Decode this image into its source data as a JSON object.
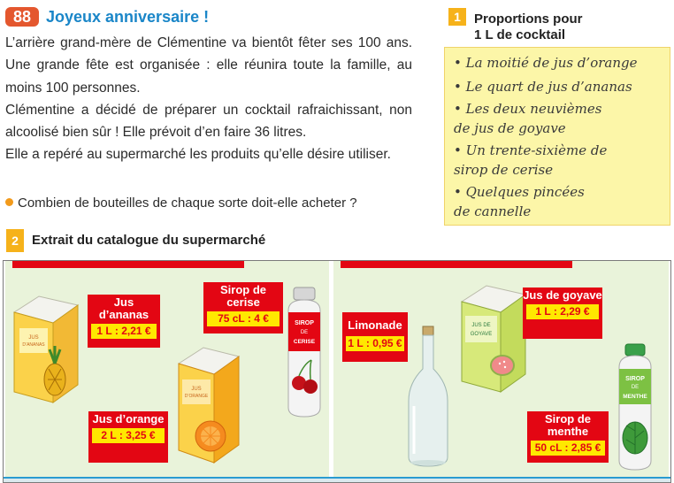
{
  "exercise": {
    "number": "88",
    "title": "Joyeux anniversaire !",
    "paragraphs": [
      "L’arrière grand-mère de Clémentine va bientôt fêter ses 100 ans. Une grande fête est organisée : elle réunira toute la famille, au moins 100 personnes.",
      "Clémentine a décidé de préparer un cocktail rafraichissant, non alcoolisé bien sûr ! Elle prévoit d’en faire 36 litres.",
      "Elle a repéré au supermarché les produits qu’elle désire utiliser."
    ],
    "question": "Combien de bouteilles de chaque sorte doit-elle acheter ?"
  },
  "doc1": {
    "number": "1",
    "title_line1": "Proportions pour",
    "title_line2": "1 L de cocktail",
    "items": [
      "• La moitié de jus d’orange",
      "• Le quart de jus d’ananas",
      "• Les deux neuvièmes de jus de goyave",
      "• Un trente-sixième de sirop de cerise",
      "• Quelques pincées de cannelle"
    ]
  },
  "doc2": {
    "number": "2",
    "title": "Extrait du catalogue du supermarché",
    "products": [
      {
        "name": "Jus d’ananas",
        "price": "1 L : 2,21 €",
        "pack_text": "JUS D’ANANAS"
      },
      {
        "name": "Sirop de cerise",
        "price": "75 cL : 4 €",
        "pack_text": "SIROP DE CERISE"
      },
      {
        "name": "Jus d’orange",
        "price": "2 L : 3,25 €",
        "pack_text": "JUS D’ORANGE"
      },
      {
        "name": "Limonade",
        "price": "1 L : 0,95 €"
      },
      {
        "name": "Jus de goyave",
        "price": "1 L : 2,29 €",
        "pack_text": "JUS DE GOYAVE"
      },
      {
        "name": "Sirop de menthe",
        "price": "50 cL : 2,85 €",
        "pack_text": "SIROP DE MENTHE"
      }
    ]
  },
  "colors": {
    "exercise_badge": "#e4572e",
    "title_blue": "#1a86c8",
    "doc_badge": "#f6b21a",
    "proportion_box": "#fcf6a8",
    "catalog_background": "#e9f3da",
    "tag_red": "#e30613",
    "price_yellow": "#ffe800"
  }
}
